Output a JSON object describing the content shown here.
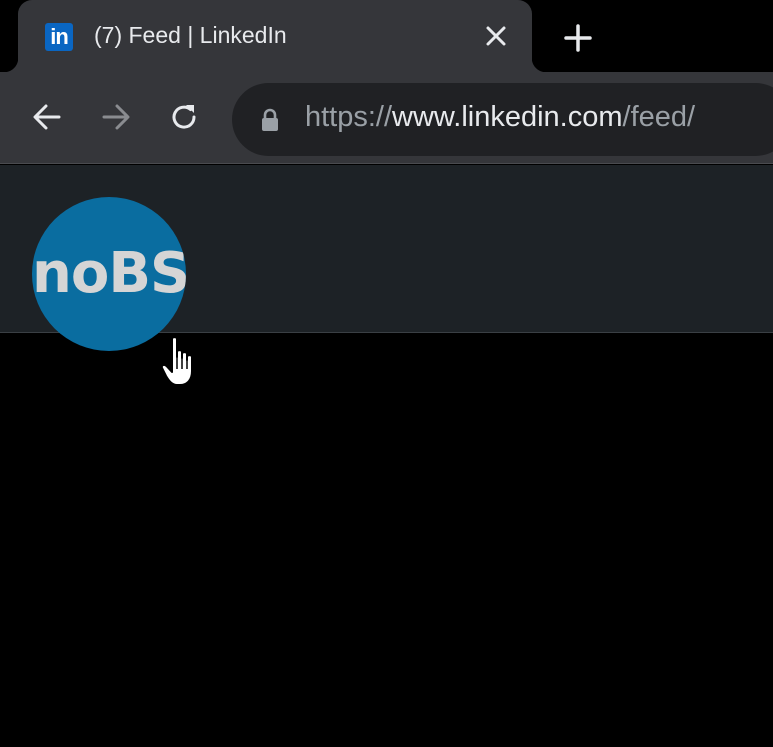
{
  "browser": {
    "tab": {
      "favicon_text": "in",
      "title": "(7) Feed | LinkedIn",
      "close_icon": "close-icon"
    },
    "new_tab_icon": "plus-icon",
    "toolbar": {
      "back_icon": "back-arrow-icon",
      "forward_icon": "forward-arrow-icon",
      "reload_icon": "reload-icon"
    },
    "address_bar": {
      "lock_icon": "lock-icon",
      "scheme": "https://",
      "host": "www.linkedin.com",
      "path": "/feed/"
    }
  },
  "page": {
    "logo_text": "noBS",
    "cursor": "hand-pointer-cursor-icon"
  },
  "colors": {
    "linkedin_blue": "#0a66c2",
    "logo_circle": "#0a6da0",
    "header_bg": "#1d2226",
    "page_bg": "#000000"
  }
}
